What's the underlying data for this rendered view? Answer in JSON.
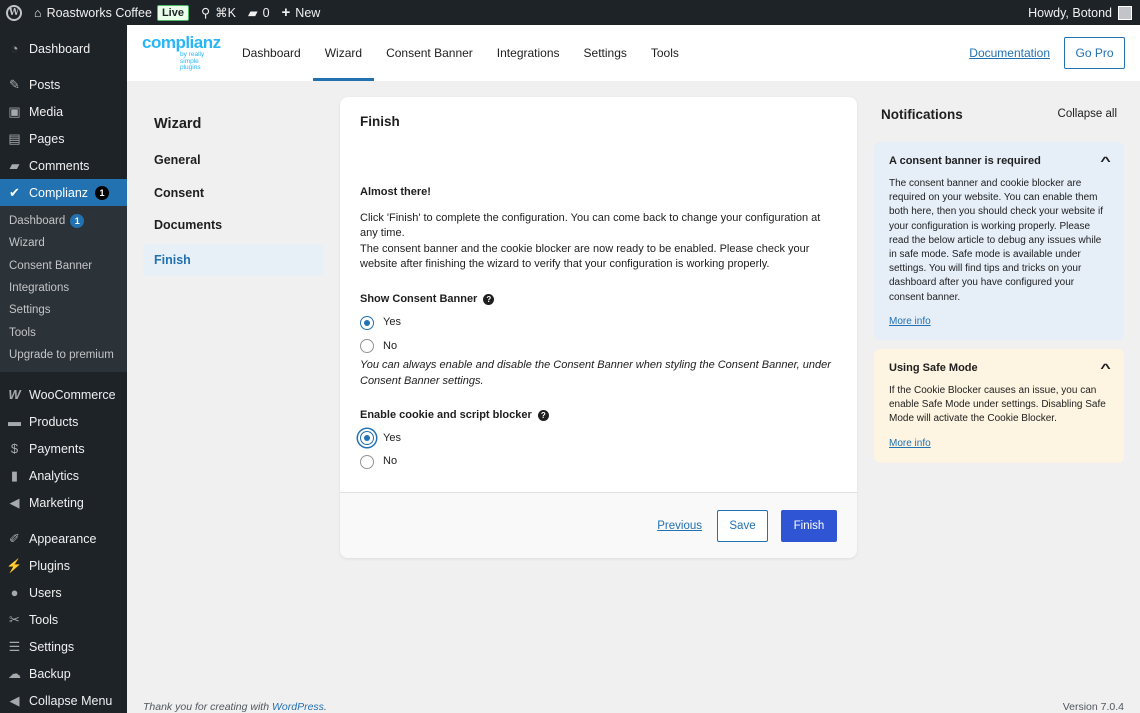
{
  "admin_bar": {
    "site_name": "Roastworks Coffee",
    "live_badge": "Live",
    "search_shortcut": "⌘K",
    "comments_count": "0",
    "new_label": "New",
    "howdy": "Howdy, Botond"
  },
  "sidebar": {
    "items_top": [
      {
        "label": "Dashboard",
        "icon": "dashboard-icon"
      },
      {
        "label": "Posts",
        "icon": "pin-icon"
      },
      {
        "label": "Media",
        "icon": "media-icon"
      },
      {
        "label": "Pages",
        "icon": "pages-icon"
      },
      {
        "label": "Comments",
        "icon": "comment-icon"
      }
    ],
    "complianz": {
      "label": "Complianz",
      "badge": "1"
    },
    "submenu": [
      {
        "label": "Dashboard",
        "badge": "1"
      },
      {
        "label": "Wizard"
      },
      {
        "label": "Consent Banner"
      },
      {
        "label": "Integrations"
      },
      {
        "label": "Settings"
      },
      {
        "label": "Tools"
      },
      {
        "label": "Upgrade to premium"
      }
    ],
    "items_bottom": [
      {
        "label": "WooCommerce",
        "icon": "woo-icon"
      },
      {
        "label": "Products",
        "icon": "archive-icon"
      },
      {
        "label": "Payments",
        "icon": "dollar-icon"
      },
      {
        "label": "Analytics",
        "icon": "bar-chart-icon"
      },
      {
        "label": "Marketing",
        "icon": "megaphone-icon"
      },
      {
        "label": "Appearance",
        "icon": "brush-icon"
      },
      {
        "label": "Plugins",
        "icon": "plug-icon"
      },
      {
        "label": "Users",
        "icon": "user-icon"
      },
      {
        "label": "Tools",
        "icon": "wrench-icon"
      },
      {
        "label": "Settings",
        "icon": "sliders-icon"
      },
      {
        "label": "Backup",
        "icon": "cloud-icon"
      },
      {
        "label": "Collapse Menu",
        "icon": "collapse-icon"
      }
    ]
  },
  "header": {
    "logo_main": "complianz",
    "logo_sub": "by really simple plugins",
    "tabs": [
      "Dashboard",
      "Wizard",
      "Consent Banner",
      "Integrations",
      "Settings",
      "Tools"
    ],
    "active_tab": "Wizard",
    "documentation": "Documentation",
    "go_pro": "Go Pro"
  },
  "wizard_menu": {
    "title": "Wizard",
    "items": [
      "General",
      "Consent",
      "Documents",
      "Finish"
    ],
    "active": "Finish"
  },
  "card": {
    "title": "Finish",
    "almost_there": "Almost there!",
    "para1": "Click 'Finish' to complete the configuration. You can come back to change your configuration at any time.",
    "para2": "The consent banner and the cookie blocker are now ready to be enabled. Please check your website after finishing the wizard to verify that your configuration is working properly.",
    "field1": {
      "label": "Show Consent Banner",
      "options": [
        "Yes",
        "No"
      ],
      "selected": "Yes",
      "note": "You can always enable and disable the Consent Banner when styling the Consent Banner, under Consent Banner settings."
    },
    "field2": {
      "label": "Enable cookie and script blocker",
      "options": [
        "Yes",
        "No"
      ],
      "selected": "Yes"
    },
    "footer": {
      "previous": "Previous",
      "save": "Save",
      "finish": "Finish"
    }
  },
  "notifications": {
    "title": "Notifications",
    "collapse_all": "Collapse all",
    "items": [
      {
        "title": "A consent banner is required",
        "body": "The consent banner and cookie blocker are required on your website. You can enable them both here, then you should check your website if your configuration is working properly. Please read the below article to debug any issues while in safe mode. Safe mode is available under settings. You will find tips and tricks on your dashboard after you have configured your consent banner.",
        "link": "More info",
        "color": "#e6eef8"
      },
      {
        "title": "Using Safe Mode",
        "body": "If the Cookie Blocker causes an issue, you can enable Safe Mode under settings. Disabling Safe Mode will activate the Cookie Blocker.",
        "link": "More info",
        "color": "#fdf4e1"
      }
    ]
  },
  "footer": {
    "thanks_prefix": "Thank you for creating with ",
    "thanks_link": "WordPress",
    "thanks_suffix": ".",
    "version": "Version 7.0.4"
  },
  "colors": {
    "accent": "#2271b1",
    "admin_bg": "#1d2327",
    "finish_button": "#2f55d4"
  }
}
